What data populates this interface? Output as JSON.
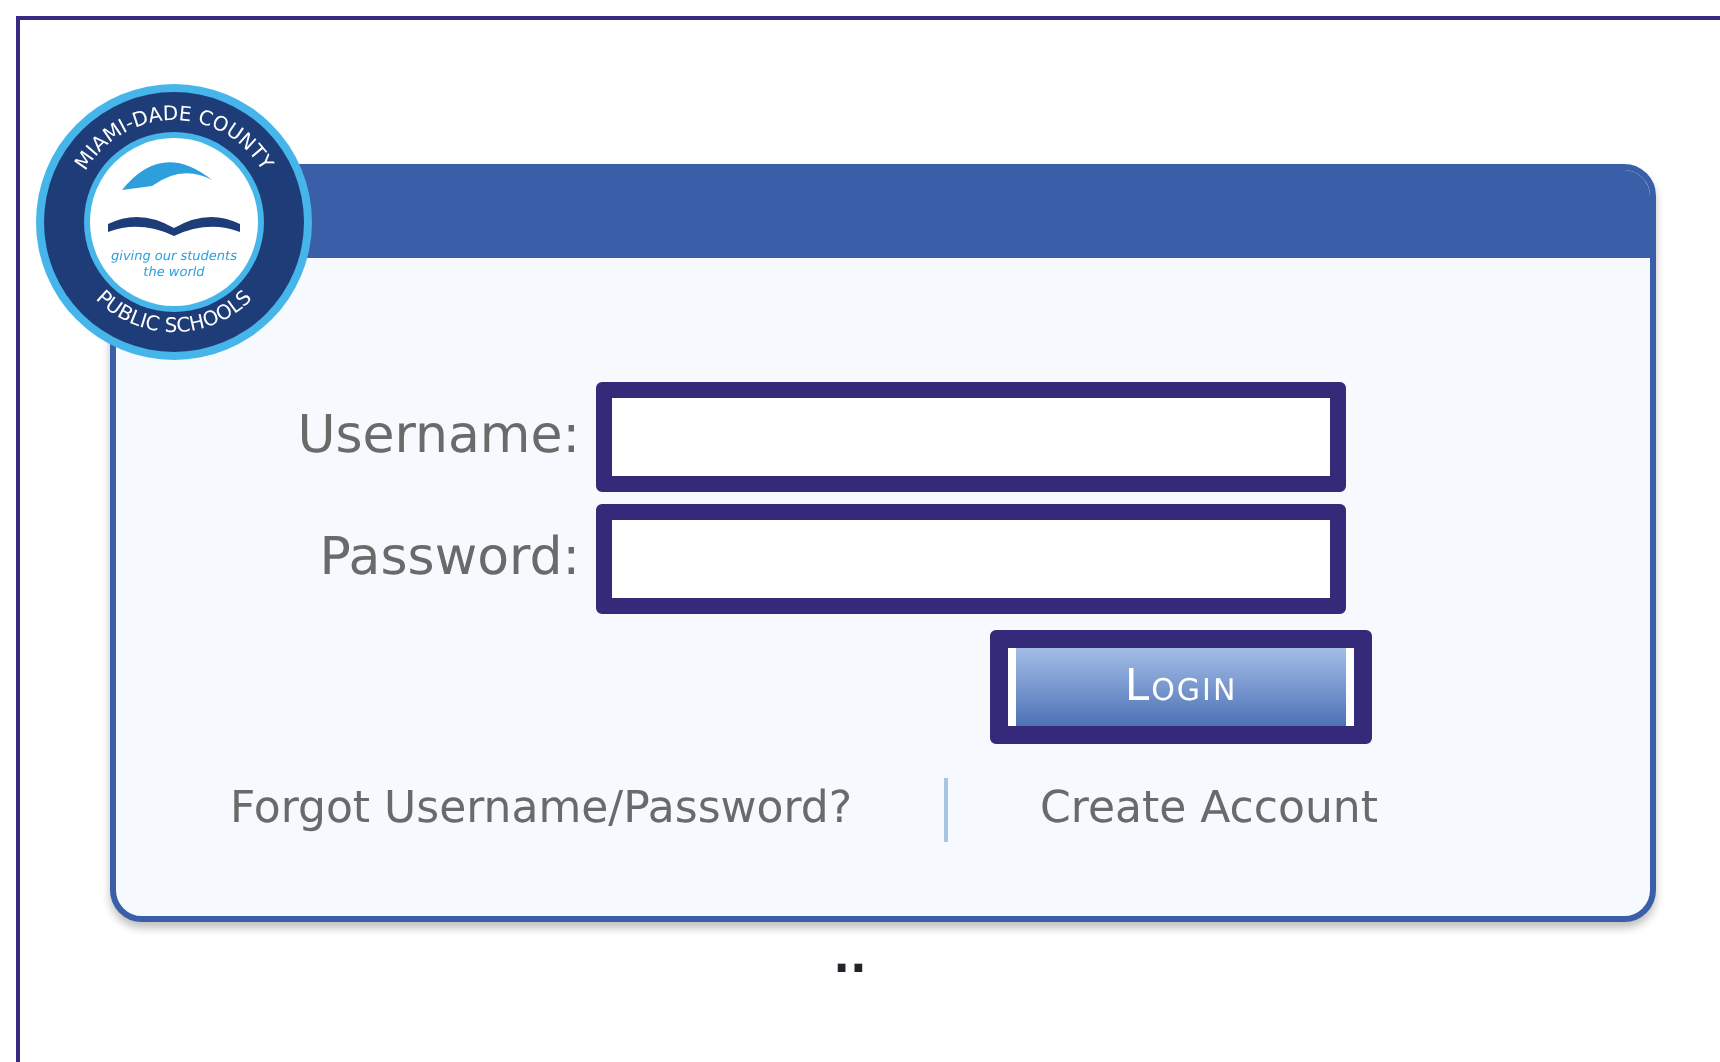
{
  "logo": {
    "top_arc": "MIAMI-DADE COUNTY",
    "bottom_arc": "PUBLIC SCHOOLS",
    "tagline": [
      "giving our students",
      "the world"
    ]
  },
  "form": {
    "fields": [
      {
        "label": "Username:"
      },
      {
        "label": "Password:"
      }
    ],
    "button": "Login"
  },
  "links": [
    "Forgot Username/Password?",
    "Create Account"
  ],
  "footer_mark": ".."
}
